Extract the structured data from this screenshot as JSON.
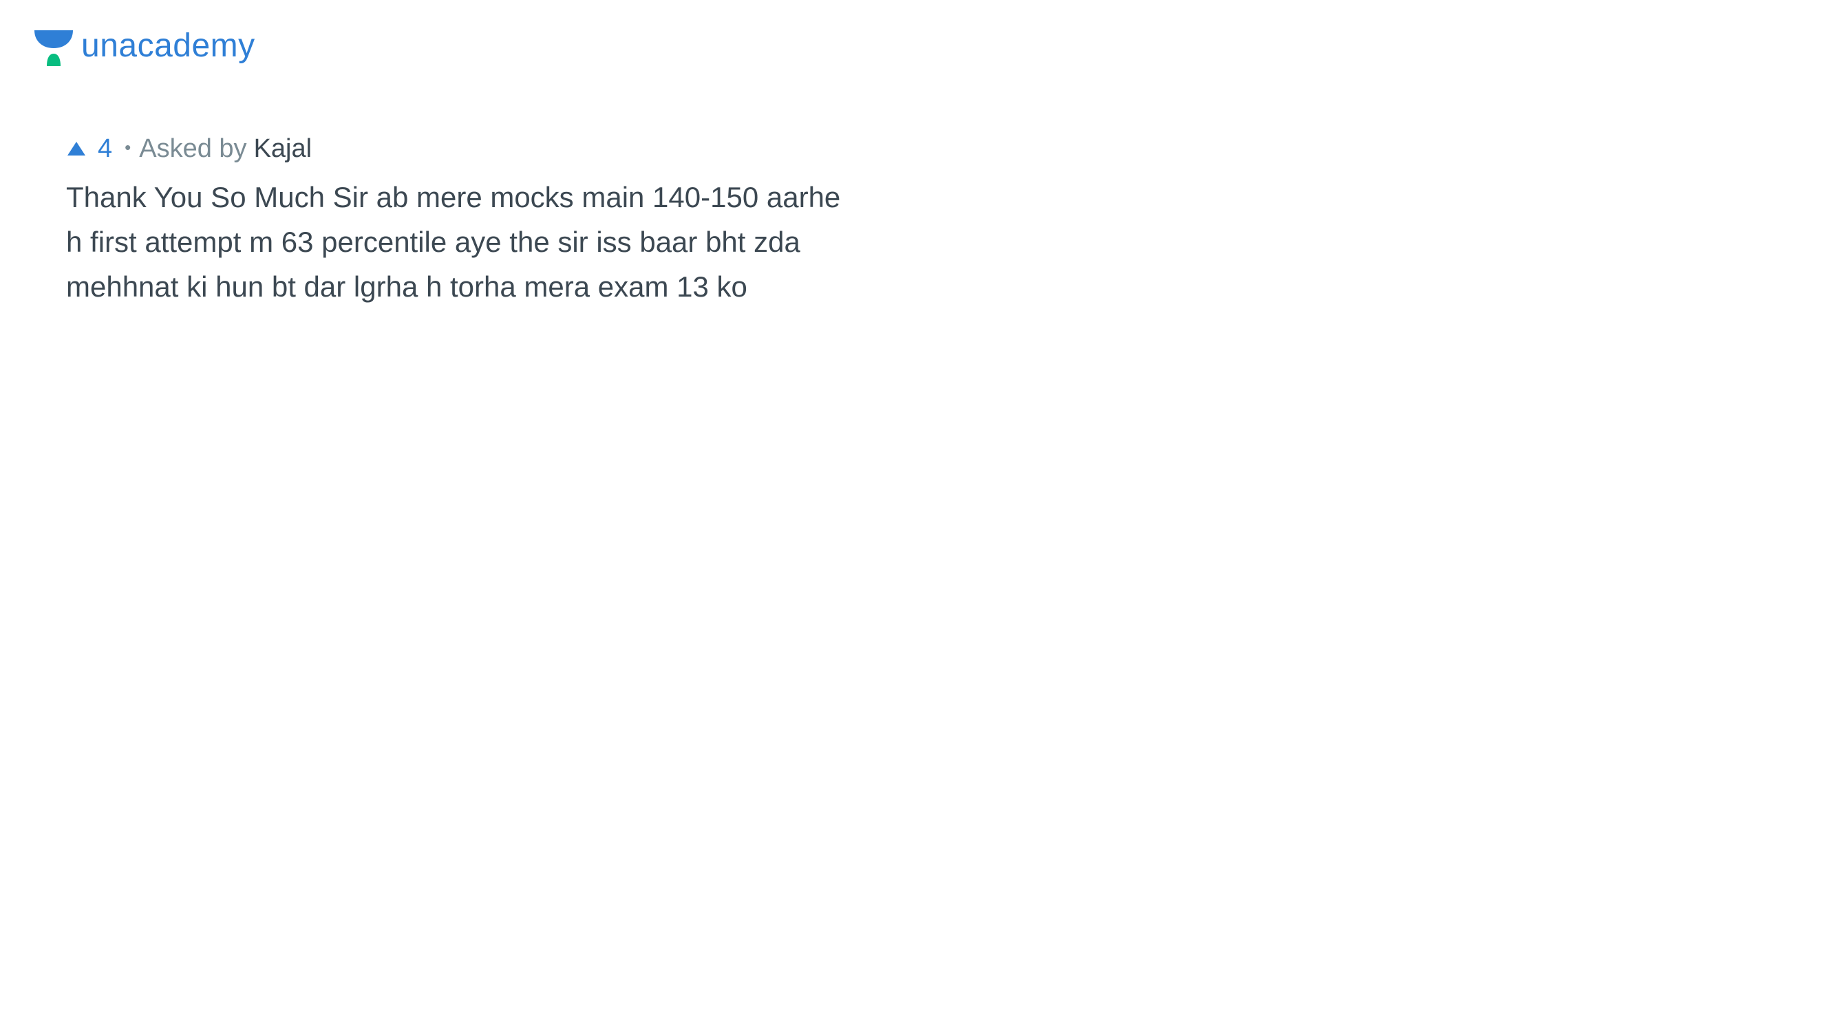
{
  "brand": {
    "name": "unacademy",
    "colors": {
      "blue": "#2f7fd6",
      "green": "#08bd80"
    }
  },
  "question": {
    "votes": "4",
    "separator": "•",
    "asked_by_label": "Asked by",
    "author": "Kajal",
    "text": "Thank You So Much Sir ab mere mocks main 140-150 aarhe\nh first attempt m 63 percentile aye the sir iss baar bht zda\nmehhnat ki hun bt dar lgrha h torha mera exam 13 ko"
  }
}
